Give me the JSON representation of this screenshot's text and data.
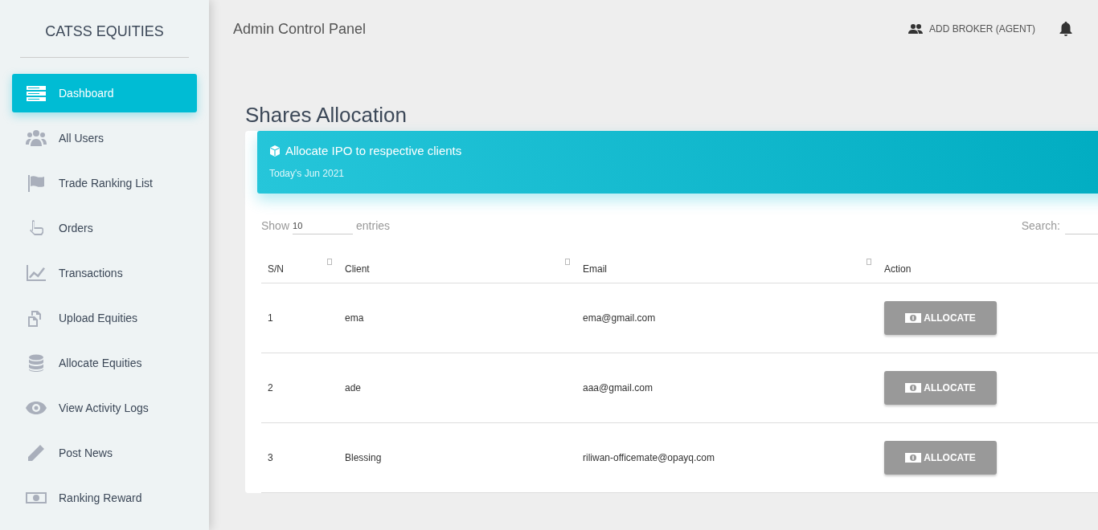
{
  "sidebar": {
    "brand": "CATSS EQUITIES",
    "items": [
      {
        "label": "Dashboard",
        "selected": true
      },
      {
        "label": "All Users",
        "selected": false
      },
      {
        "label": "Trade Ranking List",
        "selected": false
      },
      {
        "label": "Orders",
        "selected": false
      },
      {
        "label": "Transactions",
        "selected": false
      },
      {
        "label": "Upload Equities",
        "selected": false
      },
      {
        "label": "Allocate Equities",
        "selected": false
      },
      {
        "label": "View Activity Logs",
        "selected": false
      },
      {
        "label": "Post News",
        "selected": false
      },
      {
        "label": "Ranking Reward",
        "selected": false
      }
    ]
  },
  "topbar": {
    "title": "Admin Control Panel",
    "add_broker": "ADD BROKER (AGENT)"
  },
  "page_title": "Shares Allocation",
  "card": {
    "title": "Allocate IPO to respective clients",
    "subtitle": "Today's Jun 2021",
    "show_label": "Show",
    "entries_value": "10",
    "entries_label": "entries",
    "search_label": "Search:",
    "table": {
      "columns": [
        "S/N",
        "Client",
        "Email",
        "Action"
      ],
      "rows": [
        {
          "sn": "1",
          "client": "ema",
          "email": "ema@gmail.com",
          "action": "ALLOCATE"
        },
        {
          "sn": "2",
          "client": "ade",
          "email": "aaa@gmail.com",
          "action": "ALLOCATE"
        },
        {
          "sn": "3",
          "client": "Blessing",
          "email": "riliwan-officemate@opayq.com",
          "action": "ALLOCATE"
        }
      ]
    }
  }
}
